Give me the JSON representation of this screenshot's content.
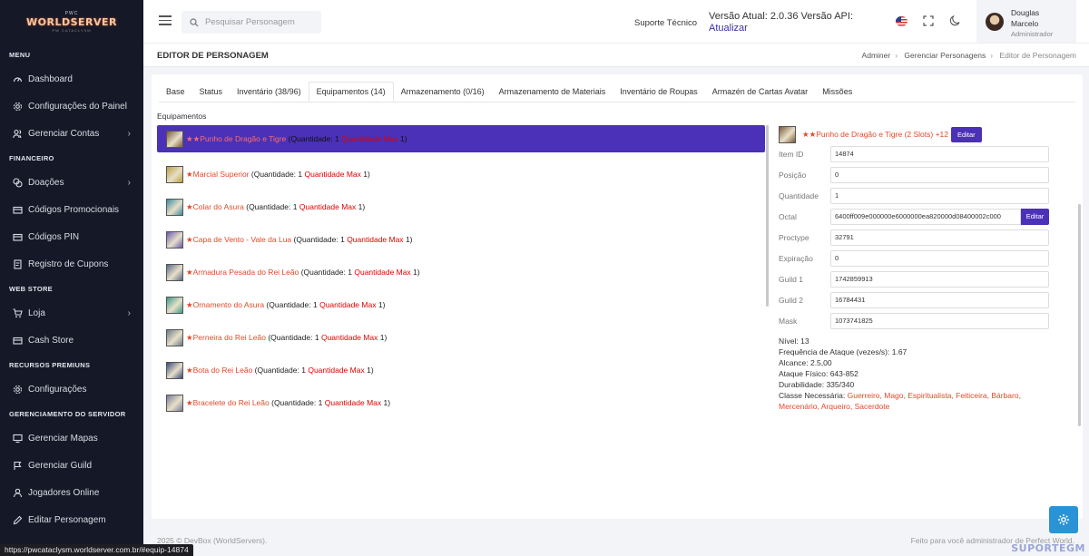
{
  "logo": {
    "top": "PWC",
    "main": "WORLDSERVER",
    "sub": "PW CATACLYSM"
  },
  "sidebar": {
    "sections": [
      {
        "title": "MENU",
        "items": [
          {
            "label": "Dashboard",
            "icon": "gauge-icon",
            "chevron": false
          },
          {
            "label": "Configurações do Painel",
            "icon": "gear-icon",
            "chevron": false
          },
          {
            "label": "Gerenciar Contas",
            "icon": "users-icon",
            "chevron": true
          }
        ]
      },
      {
        "title": "FINANCEIRO",
        "items": [
          {
            "label": "Doações",
            "icon": "coins-icon",
            "chevron": true
          },
          {
            "label": "Códigos Promocionais",
            "icon": "card-icon",
            "chevron": false
          },
          {
            "label": "Códigos PIN",
            "icon": "card-icon",
            "chevron": false
          },
          {
            "label": "Registro de Cupons",
            "icon": "receipt-icon",
            "chevron": false
          }
        ]
      },
      {
        "title": "WEB STORE",
        "items": [
          {
            "label": "Loja",
            "icon": "cart-icon",
            "chevron": true
          },
          {
            "label": "Cash Store",
            "icon": "card-icon",
            "chevron": false
          }
        ]
      },
      {
        "title": "RECURSOS PREMIUNS",
        "items": [
          {
            "label": "Configurações",
            "icon": "gear-icon",
            "chevron": false
          }
        ]
      },
      {
        "title": "GERENCIAMENTO DO SERVIDOR",
        "items": [
          {
            "label": "Gerenciar Mapas",
            "icon": "monitor-icon",
            "chevron": false
          },
          {
            "label": "Gerenciar Guild",
            "icon": "flag-icon",
            "chevron": false
          },
          {
            "label": "Jogadores Online",
            "icon": "user-icon",
            "chevron": false
          },
          {
            "label": "Editar Personagem",
            "icon": "pencil-icon",
            "chevron": false
          }
        ]
      }
    ]
  },
  "topbar": {
    "search_placeholder": "Pesquisar Personagem",
    "support": "Suporte Técnico",
    "version_line": "Versão Atual: 2.0.36 Versão API:",
    "update_link": "Atualizar",
    "user_first": "Douglas",
    "user_last": "Marcelo",
    "user_role": "Administrador"
  },
  "page": {
    "title": "EDITOR DE PERSONAGEM",
    "breadcrumb": [
      "Adminer",
      "Gerenciar Personagens",
      "Editor de Personagem"
    ]
  },
  "tabs": [
    {
      "label": "Base",
      "active": false
    },
    {
      "label": "Status",
      "active": false
    },
    {
      "label": "Inventário (38/96)",
      "active": false
    },
    {
      "label": "Equipamentos (14)",
      "active": true
    },
    {
      "label": "Armazenamento (0/16)",
      "active": false
    },
    {
      "label": "Armazenamento de Materiais",
      "active": false
    },
    {
      "label": "Inventário de Roupas",
      "active": false
    },
    {
      "label": "Armazén de Cartas Avatar",
      "active": false
    },
    {
      "label": "Missões",
      "active": false
    }
  ],
  "section_label": "Equipamentos",
  "qty_label": "Quantidade:",
  "max_label": "Quantidade Max",
  "items": [
    {
      "name": "★★Punho de Dragão e Tigre",
      "qty": "1",
      "max": "1",
      "selected": true,
      "color": "#7a5a3a"
    },
    {
      "name": "★Marcial Superior",
      "qty": "1",
      "max": "1",
      "selected": false,
      "color": "#b8a040"
    },
    {
      "name": "★Colar do Asura",
      "qty": "1",
      "max": "1",
      "selected": false,
      "color": "#3a8aa0"
    },
    {
      "name": "★Capa de Vento - Vale da Lua",
      "qty": "1",
      "max": "1",
      "selected": false,
      "color": "#6a5ab0"
    },
    {
      "name": "★Armadura Pesada do Rei Leão",
      "qty": "1",
      "max": "1",
      "selected": false,
      "color": "#5a6a8a"
    },
    {
      "name": "★Ornamento do Asura",
      "qty": "1",
      "max": "1",
      "selected": false,
      "color": "#3a9a8a"
    },
    {
      "name": "★Perneira do Rei Leão",
      "qty": "1",
      "max": "1",
      "selected": false,
      "color": "#6a7a8a"
    },
    {
      "name": "★Bota do Rei Leão",
      "qty": "1",
      "max": "1",
      "selected": false,
      "color": "#3a4a7a"
    },
    {
      "name": "★Bracelete do Rei Leão",
      "qty": "1",
      "max": "1",
      "selected": false,
      "color": "#7a7a9a"
    }
  ],
  "detail": {
    "title": "★★Punho de Dragão e Tigre (2 Slots) +12",
    "edit_label": "Editar",
    "fields": [
      {
        "label": "Item ID",
        "value": "14874",
        "button": false
      },
      {
        "label": "Posição",
        "value": "0",
        "button": false
      },
      {
        "label": "Quantidade",
        "value": "1",
        "button": false
      },
      {
        "label": "Octal",
        "value": "6400ff009e000000e6000000ea820000d08400002c000",
        "button": true
      },
      {
        "label": "Proctype",
        "value": "32791",
        "button": false
      },
      {
        "label": "Expiração",
        "value": "0",
        "button": false
      },
      {
        "label": "Guild 1",
        "value": "1742859913",
        "button": false
      },
      {
        "label": "Guild 2",
        "value": "16784431",
        "button": false
      },
      {
        "label": "Mask",
        "value": "1073741825",
        "button": false
      }
    ],
    "stats": [
      "Nível: 13",
      "Frequência de Ataque (vezes/s): 1.67",
      "Alcance: 2.5,00",
      "Ataque Físico: 643-852",
      "Durabilidade: 335/340"
    ],
    "class_label": "Classe Necessária:",
    "classes": "Guerreiro, Mago, Espiritualista, Feiticeira, Bárbaro, Mercenário, Arqueiro, Sacerdote"
  },
  "footer": {
    "left": "2025 © DevBox (WorldServers).",
    "right": "Feito para você administrador de Perfect World."
  },
  "status_url": "https://pwcataclysm.worldserver.com.br/#equip-14874",
  "watermark": "SUPORTEGM"
}
